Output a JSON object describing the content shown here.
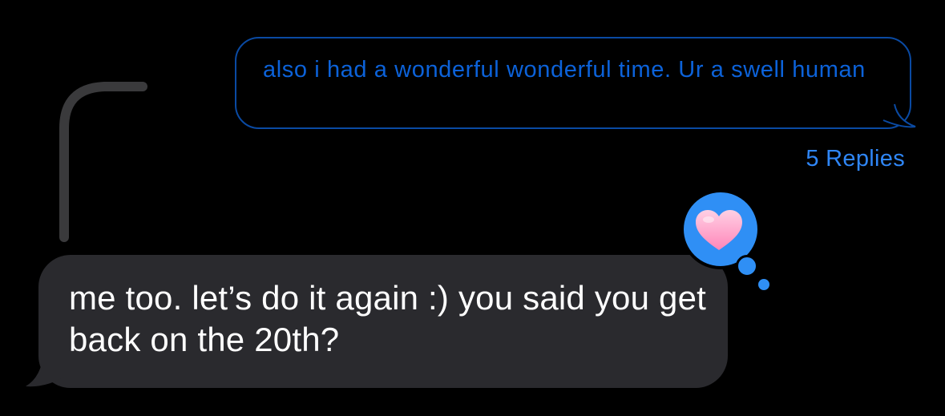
{
  "thread": {
    "outgoing_message": {
      "text": "also i had a wonderful wonderful time. Ur a swell human",
      "color": "#0c62d9",
      "border_color": "#0a4aa3"
    },
    "replies_label": "5 Replies",
    "incoming_message": {
      "text": "me too. let’s do it again :) you said you get back on the 20th?",
      "background": "#2a2a2e"
    },
    "reaction": {
      "icon": "heart-icon",
      "bubble_color": "#2f8ff5",
      "heart_color": "#ffb3d4"
    },
    "thread_line_color": "#3a3a3c"
  }
}
